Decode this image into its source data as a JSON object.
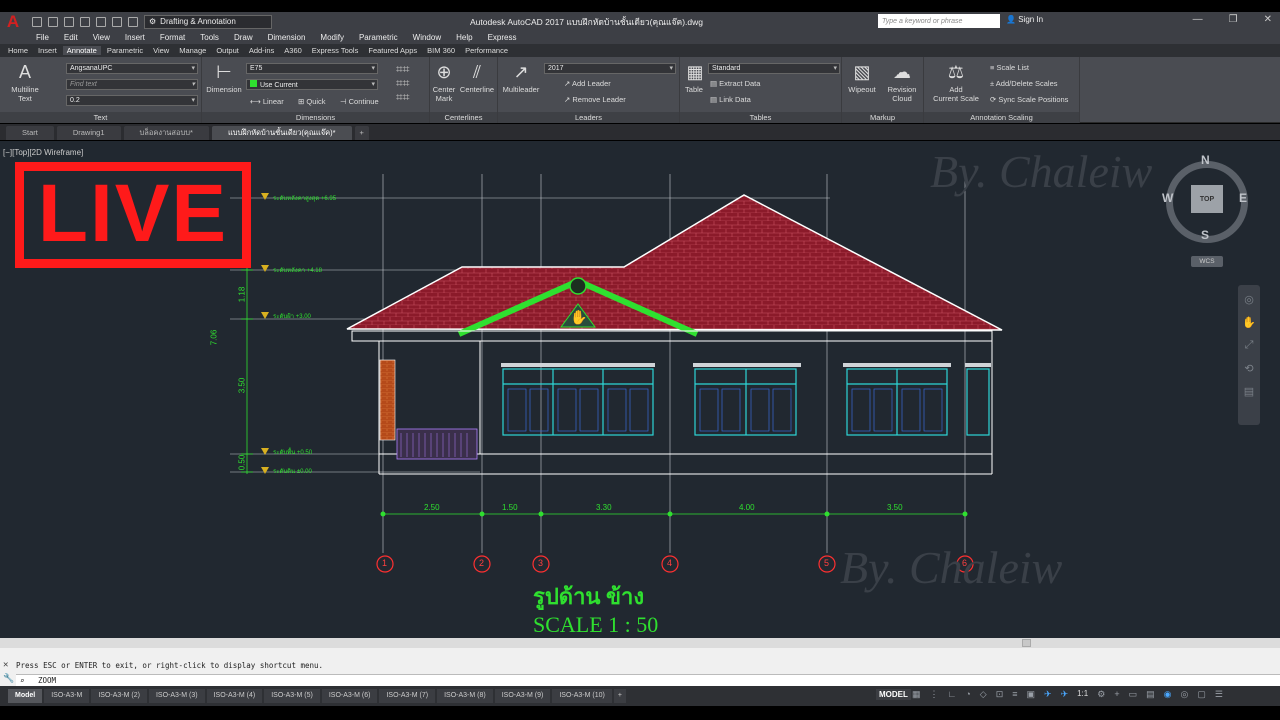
{
  "title_bar": {
    "workspace": "Drafting & Annotation",
    "app_title": "Autodesk AutoCAD 2017   แบบฝึกหัดบ้านชั้นเดียว(คุณแจ๊ค).dwg",
    "search_placeholder": "Type a keyword or phrase",
    "sign_in": "Sign In"
  },
  "menu": [
    "File",
    "Edit",
    "View",
    "Insert",
    "Format",
    "Tools",
    "Draw",
    "Dimension",
    "Modify",
    "Parametric",
    "Window",
    "Help",
    "Express"
  ],
  "ribbon_tabs": [
    "Home",
    "Insert",
    "Annotate",
    "Parametric",
    "View",
    "Manage",
    "Output",
    "Add-ins",
    "A360",
    "Express Tools",
    "Featured Apps",
    "BIM 360",
    "Performance"
  ],
  "ribbon": {
    "text": {
      "label": "Text",
      "big": "Multiline\nText",
      "font": "AngsanaUPC",
      "find": "Find text",
      "height": "0.2"
    },
    "dimensions": {
      "label": "Dimensions",
      "big": "Dimension",
      "style": "E75",
      "layer": "Use Current",
      "linear": "Linear",
      "quick": "Quick",
      "continue": "Continue"
    },
    "centerlines": {
      "label": "Centerlines",
      "center_mark": "Center\nMark",
      "centerline": "Centerline"
    },
    "leaders": {
      "label": "Leaders",
      "big": "Multileader",
      "style": "2017",
      "add": "Add Leader",
      "remove": "Remove Leader"
    },
    "tables": {
      "label": "Tables",
      "big": "Table",
      "style": "Standard",
      "extract": "Extract Data",
      "link": "Link Data"
    },
    "markup": {
      "label": "Markup",
      "wipeout": "Wipeout",
      "revcloud": "Revision\nCloud"
    },
    "scaling": {
      "label": "Annotation Scaling",
      "add_scale": "Add\nCurrent Scale",
      "scale_list": "Scale List",
      "add_delete": "Add/Delete Scales",
      "sync": "Sync Scale Positions"
    }
  },
  "doc_tabs": [
    "Start",
    "Drawing1",
    "บล็อคงานสอบบ*",
    "แบบฝึกหัดบ้านชั้นเดียว(คุณแจ๊ค)*"
  ],
  "viewport_label": "[−][Top][2D Wireframe]",
  "overlay": {
    "live": "LIVE"
  },
  "viewcube": {
    "n": "N",
    "s": "S",
    "e": "E",
    "w": "W",
    "top": "TOP",
    "wcs": "WCS"
  },
  "drawing": {
    "title_thai": "รูปด้าน ข้าง",
    "scale": "SCALE 1 : 50",
    "grid_dims": [
      "2.50",
      "1.50",
      "3.30",
      "4.00",
      "3.50"
    ],
    "grid_labels": [
      "1",
      "2",
      "3",
      "4",
      "5",
      "6"
    ],
    "vert_dims": [
      "7.06",
      "1.18",
      "3.50",
      "0.50"
    ],
    "levels": [
      "ระดับหลังคาสูงสุด +6.95",
      "ระดับหลังคา +4.18",
      "ระดับฝ้า +3.00",
      "ระดับพื้น +0.50",
      "ระดับดิน ±0.00"
    ],
    "watermark": "By. Chaleiw"
  },
  "command": {
    "history": "Press ESC or ENTER to exit, or right-click to display shortcut menu.",
    "current": "ZOOM"
  },
  "layout_tabs": [
    "Model",
    "ISO-A3-M",
    "ISO-A3-M (2)",
    "ISO-A3-M (3)",
    "ISO-A3-M (4)",
    "ISO-A3-M (5)",
    "ISO-A3-M (6)",
    "ISO-A3-M (7)",
    "ISO-A3-M (8)",
    "ISO-A3-M (9)",
    "ISO-A3-M (10)"
  ],
  "status": {
    "model": "MODEL",
    "scale": "1:1"
  }
}
